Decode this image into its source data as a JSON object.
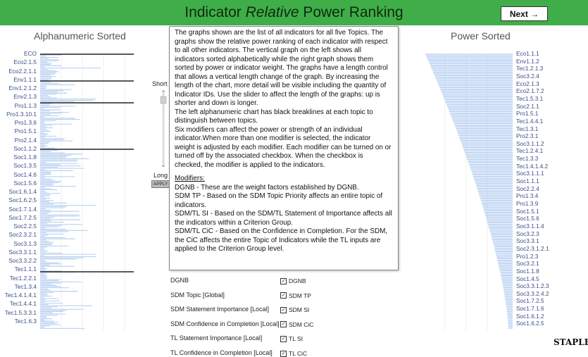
{
  "header": {
    "title_before": "Indicator ",
    "title_italic": "Relative",
    "title_after": " Power Ranking",
    "next_label": "Next →"
  },
  "left_panel": {
    "heading": "Alphanumeric Sorted",
    "labels": [
      "ECO",
      "Eco2.1.5",
      "Eco2.2.1.1",
      "Env1.1.1",
      "Env1.2.1.2",
      "Env2.1.3",
      "Pro1.1.3",
      "Pro1.3.10.1",
      "Pro1.3.6",
      "Pro1.5.1",
      "Pro2.1.4",
      "Soc1.1.2",
      "Soc1.1.8",
      "Soc1.3.5",
      "Soc1.4.6",
      "Soc1.5.6",
      "Soc1.6.1.4",
      "Soc1.6.2.5",
      "Soc1.7.1.4",
      "Soc1.7.2.5",
      "Soc2.2.5",
      "Soc2.3.2.1",
      "Soc3.1.3",
      "Soc3.3.1.1",
      "Soc3.3.2.2",
      "Tec1.1.1",
      "Tec1.2.2.1",
      "Tec1.3.4",
      "Tec1.4.1.4.1",
      "Tec1.4.4.1",
      "Tec1.5.3.3.1",
      "Tec1.6.3"
    ]
  },
  "right_panel": {
    "heading": "Power Sorted",
    "labels": [
      "Eco1.1.1",
      "Env1.1.2",
      "Tec1.2.1.3",
      "Soc3.2.4",
      "Eco2.1.3",
      "Eco2.1.7.2",
      "Tec1.5.3.1",
      "Soc2.1.1",
      "Pro1.5.1",
      "Tec1.4.4.1",
      "Tec1.3.1",
      "Pro2.3.1",
      "Soc3.1.1.2",
      "Tec1.2.4.1",
      "Tec1.3.3",
      "Tec1.4.1.4.2",
      "Soc3.1.1.1",
      "Soc1.1.1",
      "Soc2.2.4",
      "Pro1.3.4",
      "Pro1.3.9",
      "Soc1.5.1",
      "Soc1.5.6",
      "Soc3.1.1.4",
      "Soc3.2.3",
      "Soc3.3.1",
      "Soc2.3.1.2.1",
      "Pro1.2.3",
      "Soc3.2.1",
      "Soc1.1.8",
      "Soc1.4.5",
      "Soc3.3.1.2.3",
      "Soc3.3.2.4.2",
      "Soc1.7.2.5",
      "Soc1.7.1.6",
      "Soc1.6.1.2",
      "Soc1.6.2.5"
    ]
  },
  "slider": {
    "top_label": "Short",
    "bottom_label": "Long",
    "apply_label": "APPLY"
  },
  "description": {
    "p1": "The graphs shown are the list of all indicators for all five Topics. The graphs show the relative power ranking of each indicator with respect to all other indicators. The vertical graph on the left shows all indicators sorted alphabetically while the right graph shows them sorted by power or indicator weight. The graphs have a length control that allows a vertical length change of the graph. By increasing the length of the chart, more detail will be visible including the quantity of Indicator IDs. Use the slider to affect the length of the graphs: up is shorter and down is longer.",
    "p2": "The left alphanumeric chart has black breaklines at each topic to distinguish between topics.",
    "p3": "Six modifiers can affect the power or strength of an individual indicator.When more than one modifier is selected, the indicator weight is adjusted by each modifier. Each modifier can be turned on or turned off by the associated checkbox. When the checkbox is checked, the modifier is applied to the indicators.",
    "mod_heading": "Modifiers:",
    "m1": "DGNB - These are the weight factors established by DGNB.",
    "m2": "SDM TP - Based on the SDM Topic Priority affects an entire topic of indicators.",
    "m3": "SDM/TL SI - Based on the SDM/TL Statement of Importance affects all the indicators within a Criterion Group.",
    "m4": "SDM/TL CiC - Based on the Confidence in Completion. For the SDM, the CiC affects the entire Topic of Indicators while the TL inputs are applied to the Criterion Group level."
  },
  "modifiers": [
    {
      "label": "DGNB",
      "check_label": "DGNB",
      "checked": true
    },
    {
      "label": "SDM Topic [Global]",
      "check_label": "SDM TP",
      "checked": true
    },
    {
      "label": "SDM Statement Importance [Local]",
      "check_label": "SDM SI",
      "checked": true
    },
    {
      "label": "SDM Confidence in Completion [Local]",
      "check_label": "SDM CiC",
      "checked": true
    },
    {
      "label": "TL Statement Importance [Local]",
      "check_label": "TL SI",
      "checked": true
    },
    {
      "label": "TL Confidence in Completion [Local]",
      "check_label": "TL CiC",
      "checked": true
    }
  ],
  "footer": {
    "brand": "STAPLE"
  },
  "colors": {
    "accent": "#3fae49",
    "bar": "#a9c6ee",
    "breakline": "#222222"
  }
}
